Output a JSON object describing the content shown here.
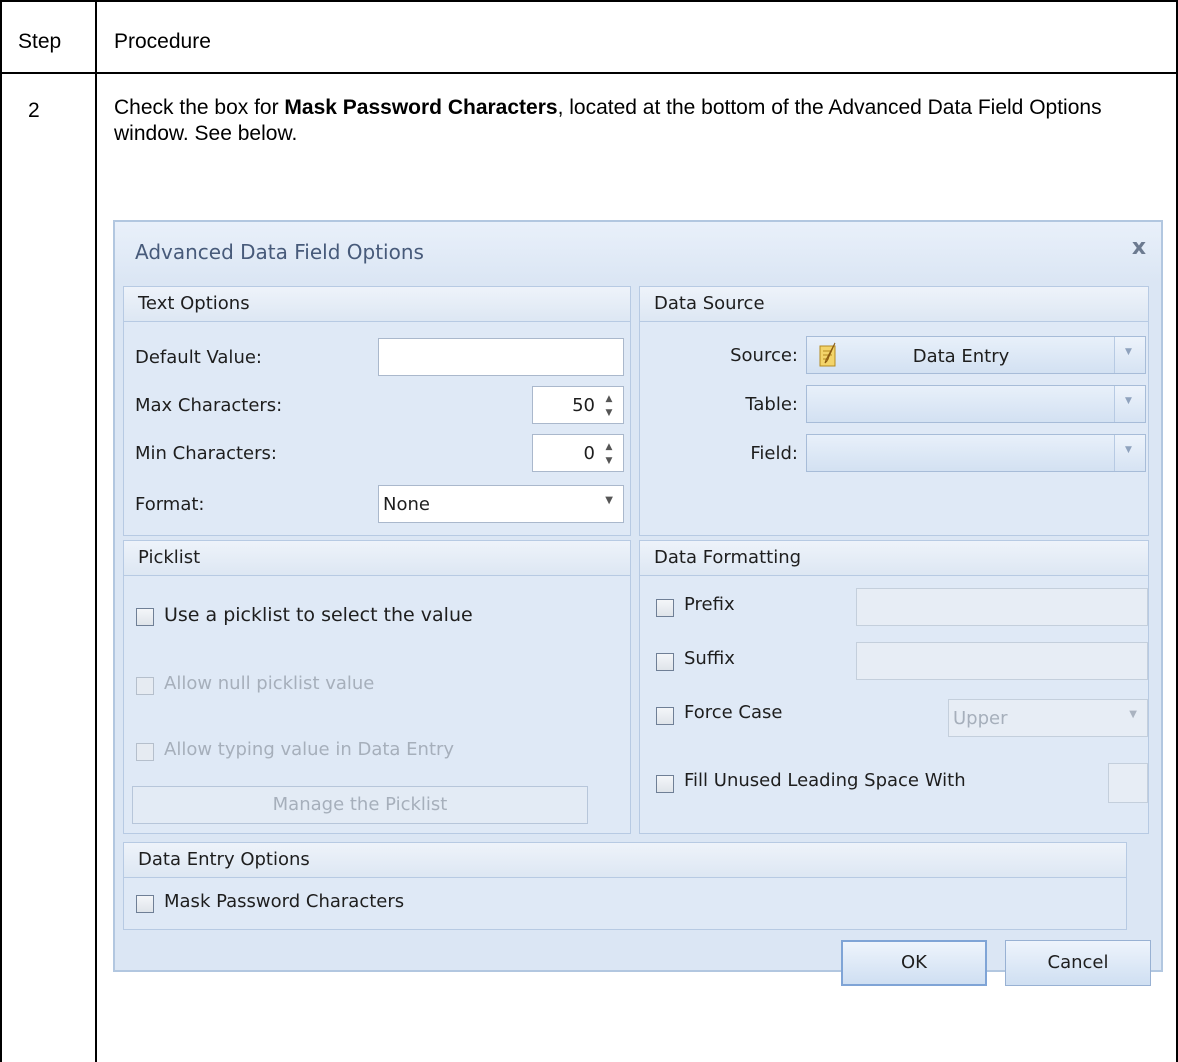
{
  "table": {
    "header_step": "Step",
    "header_procedure": "Procedure",
    "row_step": "2",
    "row_text_pre": "Check the box for ",
    "row_text_bold": "Mask Password Characters",
    "row_text_post": ", located at the bottom of the Advanced Data Field Options window. See below."
  },
  "dialog": {
    "title": "Advanced Data Field Options",
    "close_glyph": "x",
    "text_options": {
      "header": "Text Options",
      "default_value_label": "Default Value:",
      "default_value": "",
      "max_chars_label": "Max Characters:",
      "max_chars_value": "50",
      "min_chars_label": "Min Characters:",
      "min_chars_value": "0",
      "format_label": "Format:",
      "format_value": "None"
    },
    "data_source": {
      "header": "Data Source",
      "source_label": "Source:",
      "source_value": "Data Entry",
      "table_label": "Table:",
      "table_value": "",
      "field_label": "Field:",
      "field_value": ""
    },
    "picklist": {
      "header": "Picklist",
      "use_picklist": "Use a picklist to select the value",
      "allow_null": "Allow null picklist value",
      "allow_typing": "Allow typing value in Data Entry",
      "manage_button": "Manage the Picklist"
    },
    "data_formatting": {
      "header": "Data Formatting",
      "prefix": "Prefix",
      "suffix": "Suffix",
      "force_case": "Force Case",
      "force_case_value": "Upper",
      "fill_leading": "Fill Unused Leading Space With"
    },
    "data_entry_options": {
      "header": "Data Entry Options",
      "mask_password": "Mask Password Characters"
    },
    "buttons": {
      "ok": "OK",
      "cancel": "Cancel"
    }
  }
}
